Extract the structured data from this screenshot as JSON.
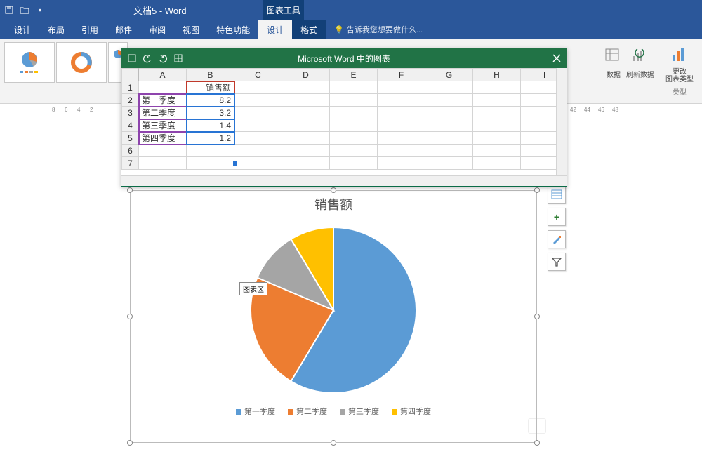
{
  "app": {
    "doc_title": "文档5 - Word",
    "chart_tools_tab": "图表工具",
    "tell_me_placeholder": "告诉我您想要做什么..."
  },
  "ribbon_tabs": [
    "设计",
    "布局",
    "引用",
    "邮件",
    "审阅",
    "视图",
    "特色功能",
    "设计",
    "格式"
  ],
  "ribbon_right": {
    "data_btn": "数据",
    "refresh_btn": "刷新数据",
    "change_type_btn": "更改\n图表类型",
    "type_group": "类型"
  },
  "ruler_ticks_left": [
    "8",
    "6",
    "4",
    "2"
  ],
  "ruler_ticks_right": [
    "42",
    "44",
    "46",
    "48"
  ],
  "excel": {
    "title": "Microsoft Word 中的图表",
    "cols": [
      "A",
      "B",
      "C",
      "D",
      "E",
      "F",
      "G",
      "H",
      "I"
    ],
    "rows": [
      {
        "n": "1",
        "A": "",
        "B": "销售额"
      },
      {
        "n": "2",
        "A": "第一季度",
        "B": "8.2"
      },
      {
        "n": "3",
        "A": "第二季度",
        "B": "3.2"
      },
      {
        "n": "4",
        "A": "第三季度",
        "B": "1.4"
      },
      {
        "n": "5",
        "A": "第四季度",
        "B": "1.2"
      },
      {
        "n": "6",
        "A": "",
        "B": ""
      },
      {
        "n": "7",
        "A": "",
        "B": ""
      }
    ]
  },
  "chart_data": {
    "type": "pie",
    "title": "销售额",
    "categories": [
      "第一季度",
      "第二季度",
      "第三季度",
      "第四季度"
    ],
    "values": [
      8.2,
      3.2,
      1.4,
      1.2
    ],
    "colors": [
      "#5b9bd5",
      "#ed7d31",
      "#a5a5a5",
      "#ffc000"
    ],
    "tooltip": "图表区",
    "legend_position": "bottom"
  }
}
